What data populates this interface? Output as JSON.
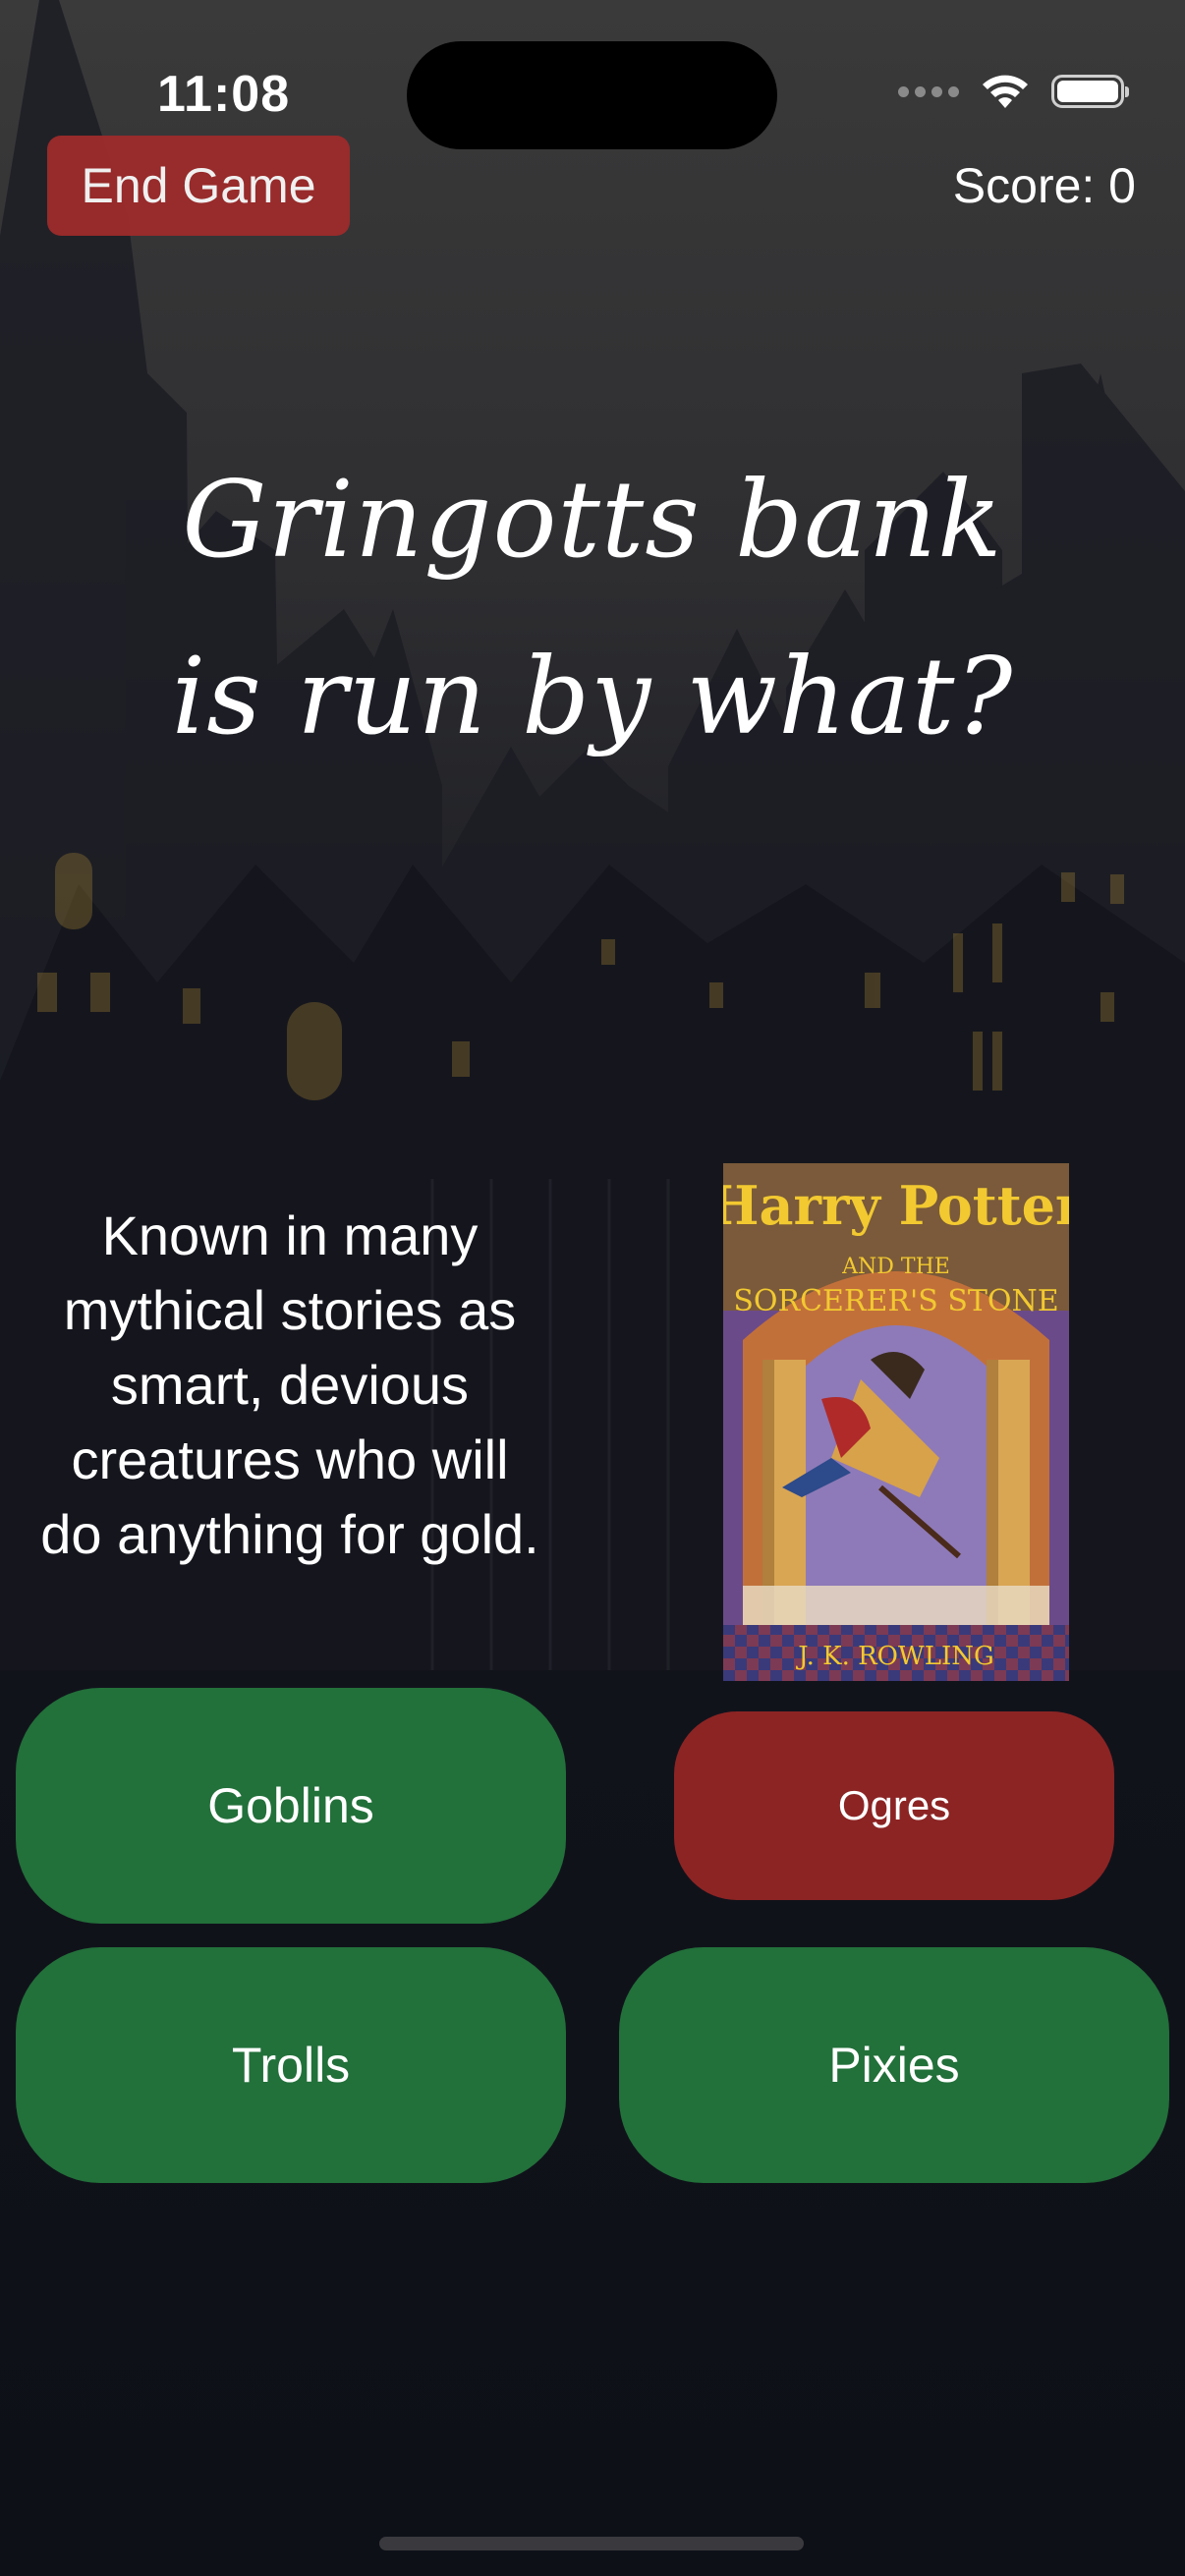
{
  "status_bar": {
    "time": "11:08",
    "icons": [
      "cellular-signal-icon",
      "wifi-icon",
      "battery-icon"
    ]
  },
  "header": {
    "end_game_label": "End Game",
    "score_text": "Score: 0"
  },
  "question": {
    "text": "Gringotts bank is run by what?"
  },
  "hint": {
    "text": "Known in many mythical stories as smart, devious creatures who will do anything for gold."
  },
  "book": {
    "title_line1": "Harry Potter",
    "title_line2": "AND THE",
    "title_line3": "SORCERER'S STONE",
    "author": "J. K. ROWLING"
  },
  "answers": [
    {
      "label": "Goblins",
      "state": "default"
    },
    {
      "label": "Ogres",
      "state": "wrong"
    },
    {
      "label": "Trolls",
      "state": "default"
    },
    {
      "label": "Pixies",
      "state": "default"
    }
  ],
  "colors": {
    "answer_default": "#22703a",
    "answer_wrong": "#8c2424",
    "end_game": "#a02b2b"
  }
}
